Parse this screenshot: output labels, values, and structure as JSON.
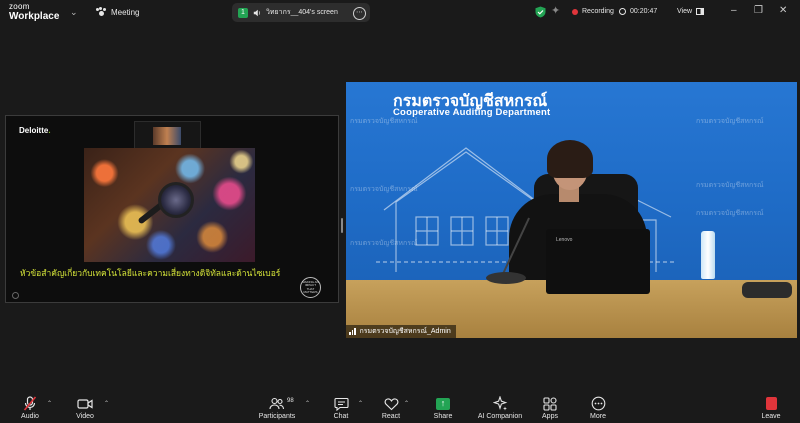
{
  "app": {
    "brand_top": "zoom",
    "brand_bottom": "Workplace"
  },
  "topbar": {
    "meeting_label": "Meeting",
    "share_pill": {
      "badge": "1",
      "label": "วิทยากร__404's screen"
    },
    "recording_label": "Recording",
    "timer": "00:20:47",
    "view_label": "View"
  },
  "shared_screen": {
    "brand": "Deloitte",
    "brand_dot": ".",
    "title": "หัวข้อสำคัญเกี่ยวกับเทคโนโลยีและความเสี่ยงทางดิจิทัลและด้านไซเบอร์",
    "badge_text": "MAKING AN IMPACT THAT MATTERS"
  },
  "participant": {
    "backdrop_title": "กรมตรวจบัญชีสหกรณ์",
    "backdrop_subtitle": "Cooperative Auditing Department",
    "laptop_brand": "Lenovo",
    "name": "กรมตรวจบัญชีสหกรณ์_Admin",
    "watermark": "กรมตรวจบัญชีสหกรณ์"
  },
  "toolbar": {
    "audio": "Audio",
    "video": "Video",
    "participants": "Participants",
    "participants_count": "98",
    "chat": "Chat",
    "react": "React",
    "share": "Share",
    "ai_companion": "AI Companion",
    "apps": "Apps",
    "more": "More",
    "leave": "Leave"
  },
  "colors": {
    "background": "#1a1a1a",
    "share_green": "#23a454",
    "recording_red": "#e0353b",
    "backdrop_blue": "#2777d3",
    "slide_title_yellow": "#d7e63a"
  }
}
